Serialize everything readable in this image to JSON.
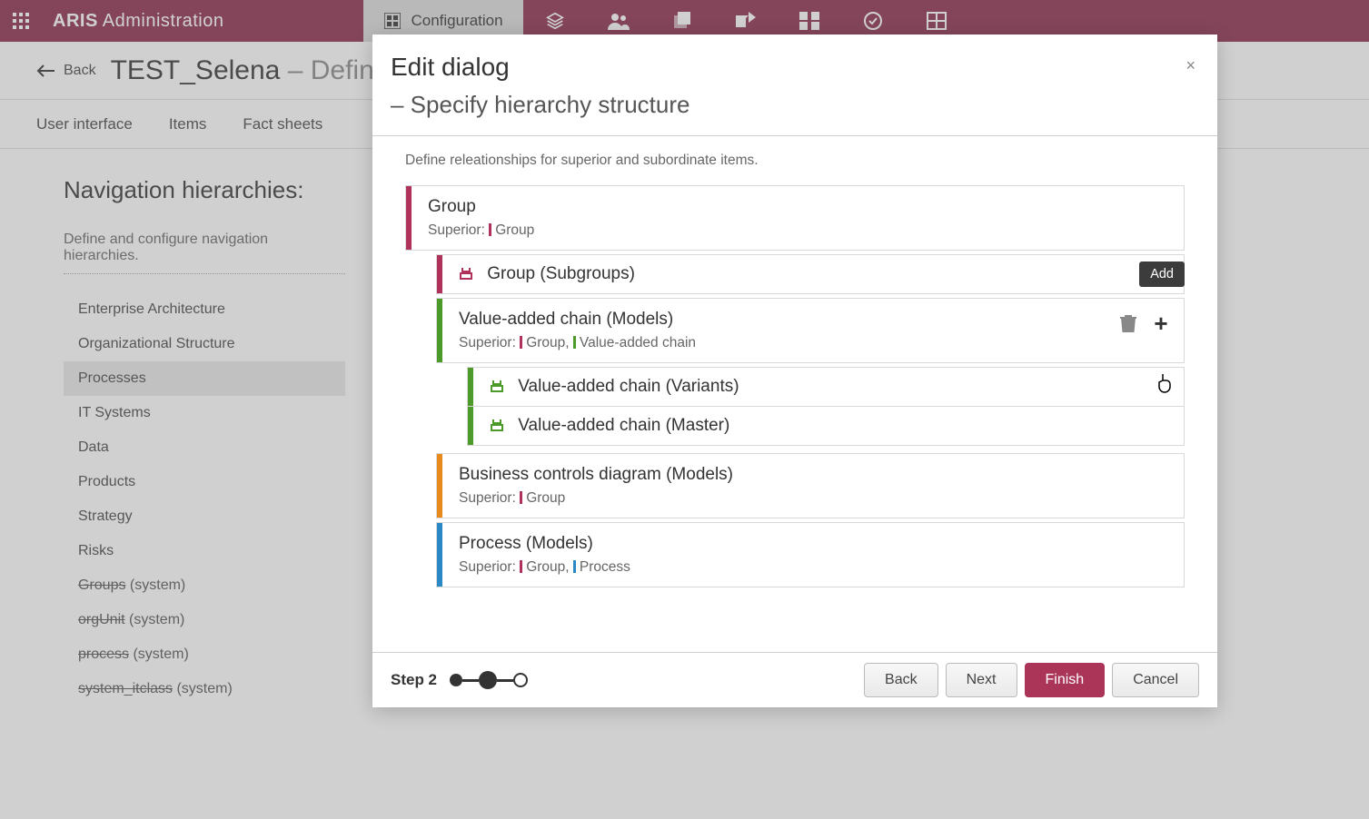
{
  "topbar": {
    "brand_html": "ARIS Administration",
    "brand_bold": "ARIS",
    "brand_rest": "Administration",
    "configuration_label": "Configuration"
  },
  "subheader": {
    "back_label": "Back",
    "title_main": "TEST_Selena",
    "title_sep": " – ",
    "title_rest": "Define n"
  },
  "tabs": {
    "items": [
      "User interface",
      "Items",
      "Fact sheets"
    ]
  },
  "sidebar": {
    "heading": "Navigation hierarchies:",
    "hint": "Define and configure navigation hierarchies.",
    "items": [
      {
        "label": "Enterprise Architecture",
        "system": false
      },
      {
        "label": "Organizational Structure",
        "system": false
      },
      {
        "label": "Processes",
        "system": false,
        "selected": true
      },
      {
        "label": "IT Systems",
        "system": false
      },
      {
        "label": "Data",
        "system": false
      },
      {
        "label": "Products",
        "system": false
      },
      {
        "label": "Strategy",
        "system": false
      },
      {
        "label": "Risks",
        "system": false
      },
      {
        "label": "Groups",
        "suffix": " (system)",
        "system": true
      },
      {
        "label": "orgUnit",
        "suffix": " (system)",
        "system": true
      },
      {
        "label": "process",
        "suffix": " (system)",
        "system": true
      },
      {
        "label": "system_itclass",
        "suffix": " (system)",
        "system": true
      }
    ]
  },
  "dialog": {
    "title": "Edit dialog",
    "subtitle": "– Specify hierarchy structure",
    "description": "Define releationships for superior and subordinate items.",
    "tooltip_add": "Add",
    "step_label": "Step 2",
    "buttons": {
      "back": "Back",
      "next": "Next",
      "finish": "Finish",
      "cancel": "Cancel"
    },
    "tree": {
      "group": {
        "title": "Group",
        "superior_label": "Superior:",
        "superior_items": [
          {
            "color": "#b0325a",
            "name": "Group"
          }
        ],
        "color": "#b0325a",
        "leaf": {
          "label": "Group (Subgroups)",
          "color": "#b0325a"
        }
      },
      "vac": {
        "title": "Value-added chain (Models)",
        "superior_label": "Superior:",
        "superior_items": [
          {
            "color": "#b0325a",
            "name": "Group,"
          },
          {
            "color": "#4c9a2a",
            "name": "Value-added chain"
          }
        ],
        "color": "#4c9a2a",
        "leaves": [
          {
            "label": "Value-added chain (Variants)",
            "color": "#4c9a2a"
          },
          {
            "label": "Value-added chain (Master)",
            "color": "#4c9a2a"
          }
        ]
      },
      "bcd": {
        "title": "Business controls diagram (Models)",
        "superior_label": "Superior:",
        "superior_items": [
          {
            "color": "#b0325a",
            "name": "Group"
          }
        ],
        "color": "#e88a1c"
      },
      "process": {
        "title": "Process (Models)",
        "superior_label": "Superior:",
        "superior_items": [
          {
            "color": "#b0325a",
            "name": "Group,"
          },
          {
            "color": "#2a88c7",
            "name": "Process"
          }
        ],
        "color": "#2a88c7"
      }
    }
  }
}
